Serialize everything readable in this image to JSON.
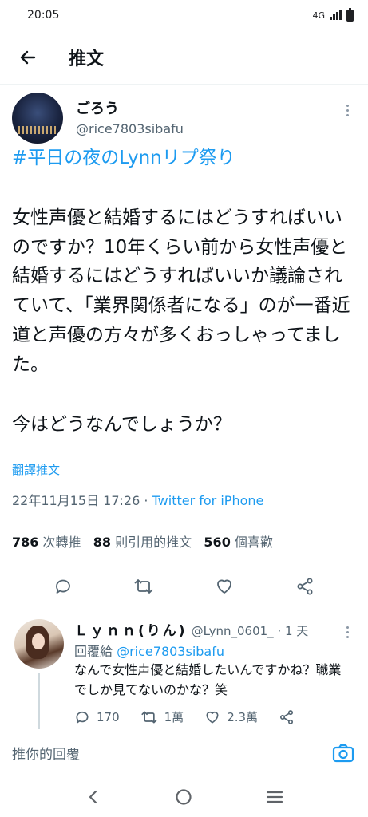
{
  "status_bar": {
    "time": "20:05",
    "network": "4G"
  },
  "header": {
    "title": "推文"
  },
  "tweet": {
    "author_name": "ごろう",
    "author_handle": "@rice7803sibafu",
    "hashtag": "#平日の夜のLynnリプ祭り",
    "paragraph1": "女性声優と結婚するにはどうすればいいのですか？10年くらい前から女性声優と結婚するにはどうすればいいか議論されていて、「業界関係者になる」のが一番近道と声優の方々が多くおっしゃってました。",
    "paragraph2": "今はどうなんでしょうか？",
    "translate_label": "翻譯推文",
    "timestamp": "22年11月15日 17:26",
    "separator": " · ",
    "source": "Twitter for iPhone",
    "stats": {
      "retweets": "786",
      "retweets_label": "次轉推",
      "quotes": "88",
      "quotes_label": "則引用的推文",
      "likes": "560",
      "likes_label": "個喜歡"
    },
    "actions": [
      "reply-icon",
      "retweet-icon",
      "like-icon",
      "share-icon"
    ]
  },
  "reply": {
    "name": "Ｌｙｎｎ(りん)",
    "handle": "@Lynn_0601_",
    "time": " · 1 天",
    "reply_to_prefix": "回覆給 ",
    "reply_to_mention": "@rice7803sibafu",
    "text": "なんで女性声優と結婚したいんですかね？職業でしか見てないのかな？笑",
    "reply_count": "170",
    "retweet_count": "1萬",
    "like_count": "2.3萬"
  },
  "compose": {
    "placeholder": "推你的回覆"
  },
  "colors": {
    "accent": "#1d9bf0",
    "text": "#0f1419",
    "secondary": "#536471"
  }
}
